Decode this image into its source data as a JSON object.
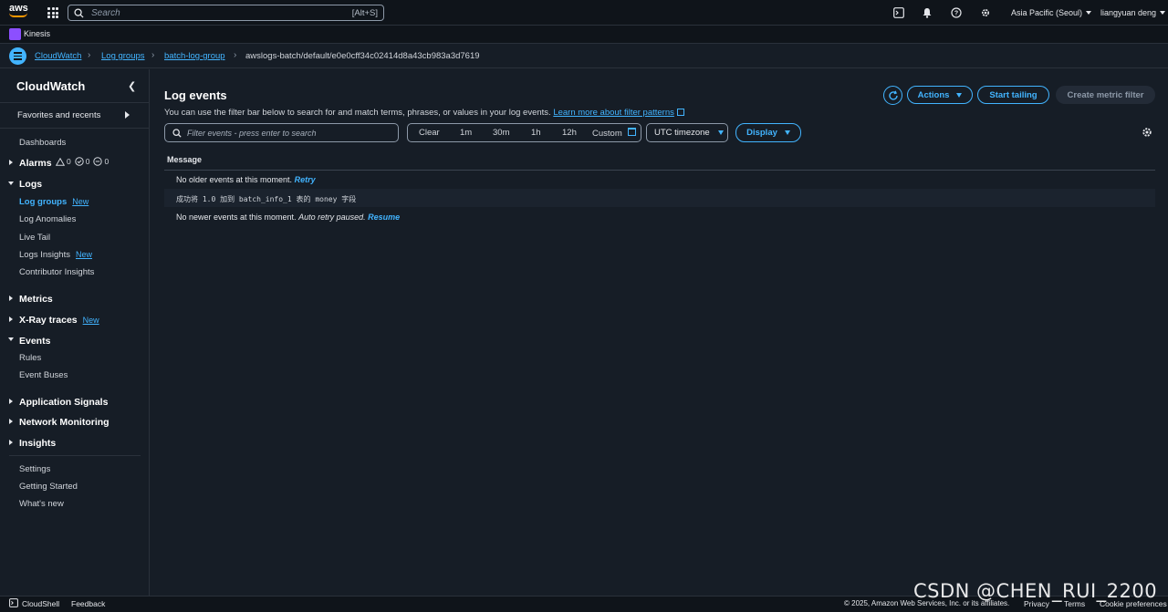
{
  "topnav": {
    "logo_text": "aws",
    "search_placeholder": "Search",
    "search_shortcut": "[Alt+S]",
    "region": "Asia Pacific (Seoul)",
    "user": "liangyuan deng"
  },
  "servicebar": {
    "service": "Kinesis"
  },
  "breadcrumb": {
    "items": [
      "CloudWatch",
      "Log groups",
      "batch-log-group"
    ],
    "current": "awslogs-batch/default/e0e0cff34c02414d8a43cb983a3d7619"
  },
  "sidebar": {
    "title": "CloudWatch",
    "favorites": "Favorites and recents",
    "dashboards": "Dashboards",
    "alarms": {
      "label": "Alarms",
      "in_alarm": "0",
      "ok": "0",
      "insufficient": "0"
    },
    "logs": {
      "label": "Logs",
      "items": [
        "Log groups",
        "Log Anomalies",
        "Live Tail",
        "Logs Insights",
        "Contributor Insights"
      ]
    },
    "new_badge": "New",
    "metrics": "Metrics",
    "xray": "X-Ray traces",
    "events": {
      "label": "Events",
      "items": [
        "Rules",
        "Event Buses"
      ]
    },
    "app_signals": "Application Signals",
    "network": "Network Monitoring",
    "insights": "Insights",
    "bottom": [
      "Settings",
      "Getting Started",
      "What's new"
    ]
  },
  "main": {
    "title": "Log events",
    "description": "You can use the filter bar below to search for and match terms, phrases, or values in your log events.",
    "learn_more": "Learn more about filter patterns",
    "actions": "Actions",
    "start_tailing": "Start tailing",
    "create_metric_filter": "Create metric filter",
    "filter_placeholder": "Filter events - press enter to search",
    "time_options": [
      "Clear",
      "1m",
      "30m",
      "1h",
      "12h",
      "Custom"
    ],
    "timezone": "UTC timezone",
    "display": "Display",
    "column_message": "Message",
    "row_older": "No older events at this moment.",
    "retry": "Retry",
    "log_line": "成功将 1.0 加到 batch_info_1 表的 money 字段",
    "row_newer": "No newer events at this moment.",
    "auto_retry": "Auto retry paused.",
    "resume": "Resume"
  },
  "footer": {
    "cloudshell": "CloudShell",
    "feedback": "Feedback",
    "copyright": "© 2025, Amazon Web Services, Inc. or its affiliates.",
    "privacy": "Privacy",
    "terms": "Terms",
    "cookies": "Cookie preferences"
  },
  "watermark": "CSDN @CHEN_RUI_2200",
  "colors": {
    "accent": "#42b4ff",
    "bg": "#161d26",
    "nav": "#0f141a",
    "brand": "#ff9900"
  }
}
